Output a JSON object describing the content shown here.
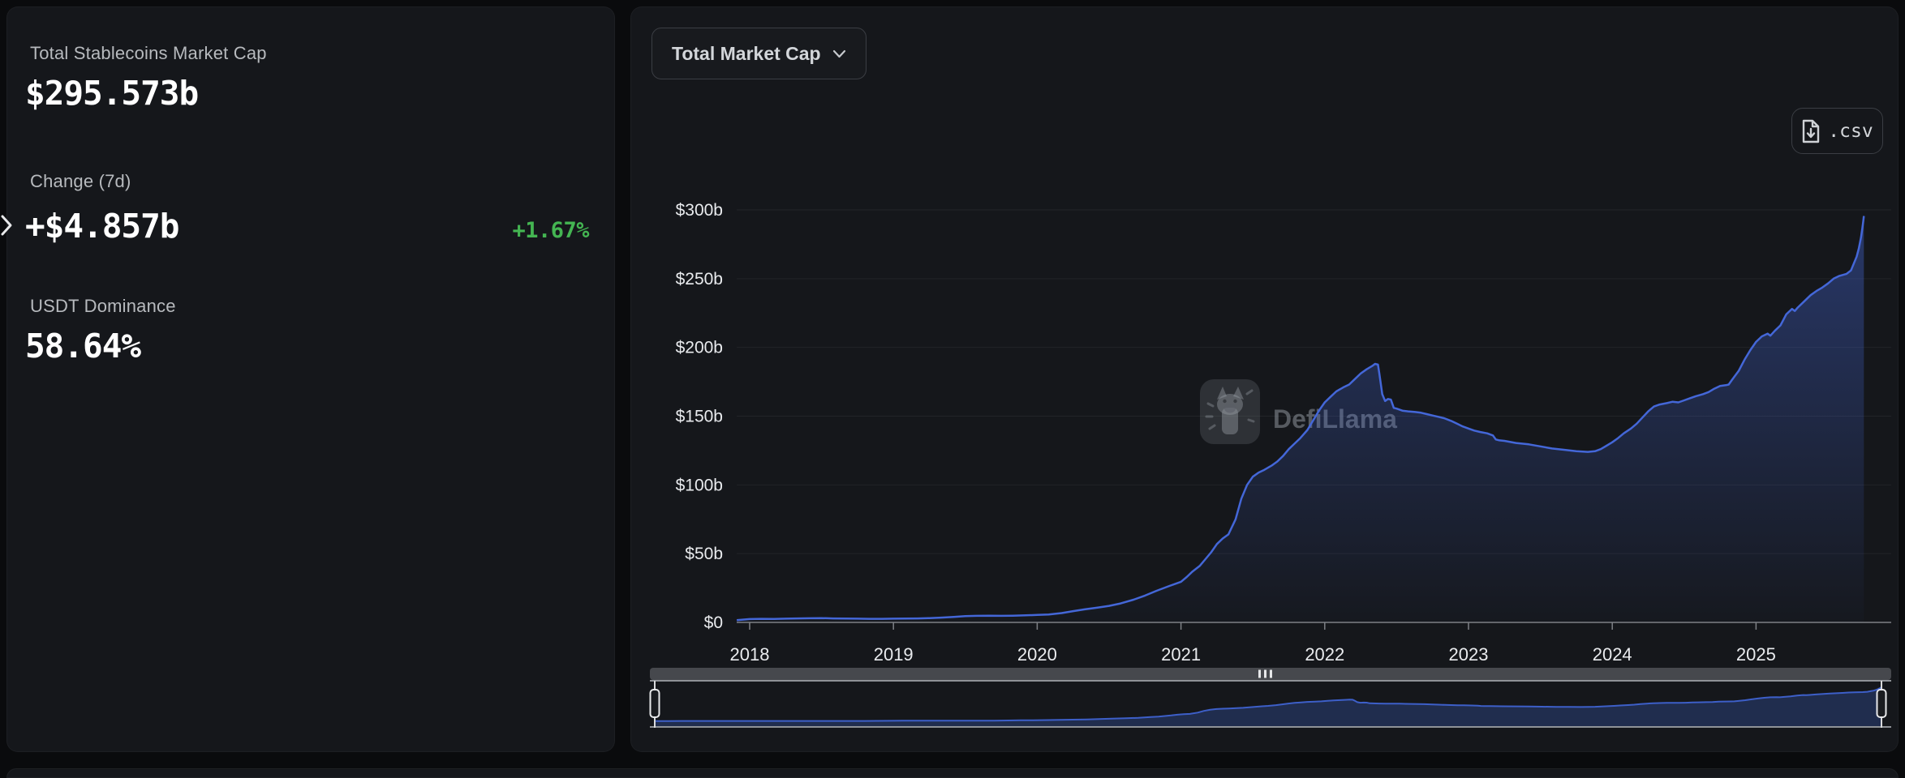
{
  "stats_panel": {
    "items": [
      {
        "label": "Total Stablecoins Market Cap",
        "value": "$295.573b"
      },
      {
        "label": "Change (7d)",
        "value": "+$4.857b",
        "change_pct": "+1.67%"
      },
      {
        "label": "USDT Dominance",
        "value": "58.64%"
      }
    ]
  },
  "chart_panel": {
    "metric_dropdown": {
      "label": "Total Market Cap"
    },
    "csv_button": {
      "label": ".csv"
    },
    "watermark": "DefiLlama"
  },
  "colors": {
    "positive_green": "#44b552",
    "line_blue": "#4467d8",
    "nav_fill_blue": "rgba(61,95,200,0.30)",
    "nav_line_blue": "#3d5fc8",
    "axis_gray": "#7e8186",
    "tick_text": "#e9ebee",
    "scrollbar_gray": "#46484d",
    "handle_stroke": "#e8e9eb"
  },
  "chart_data": {
    "type": "area",
    "title": "Total Market Cap",
    "xlabel": "",
    "ylabel": "",
    "ylim": [
      0,
      300
    ],
    "xlim": [
      2017.91,
      2025.75
    ],
    "grid": true,
    "legend_position": "none",
    "y_ticks": [
      "$0",
      "$50b",
      "$100b",
      "$150b",
      "$200b",
      "$250b",
      "$300b"
    ],
    "x_ticks": [
      "2018",
      "2019",
      "2020",
      "2021",
      "2022",
      "2023",
      "2024",
      "2025"
    ],
    "series": [
      {
        "name": "Total Stablecoins Market Cap",
        "unit": "USD billions",
        "points": [
          [
            2017.91,
            1.6
          ],
          [
            2018.0,
            2.4
          ],
          [
            2018.08,
            2.6
          ],
          [
            2018.17,
            2.5
          ],
          [
            2018.25,
            2.7
          ],
          [
            2018.33,
            2.9
          ],
          [
            2018.42,
            3.0
          ],
          [
            2018.5,
            3.1
          ],
          [
            2018.58,
            2.9
          ],
          [
            2018.67,
            2.8
          ],
          [
            2018.75,
            2.7
          ],
          [
            2018.83,
            2.6
          ],
          [
            2018.92,
            2.6
          ],
          [
            2019.0,
            2.7
          ],
          [
            2019.08,
            2.8
          ],
          [
            2019.17,
            2.9
          ],
          [
            2019.25,
            3.1
          ],
          [
            2019.33,
            3.5
          ],
          [
            2019.42,
            4.0
          ],
          [
            2019.5,
            4.6
          ],
          [
            2019.58,
            4.8
          ],
          [
            2019.67,
            4.9
          ],
          [
            2019.75,
            4.8
          ],
          [
            2019.83,
            4.9
          ],
          [
            2019.92,
            5.1
          ],
          [
            2020.0,
            5.4
          ],
          [
            2020.08,
            5.7
          ],
          [
            2020.17,
            6.8
          ],
          [
            2020.25,
            8.2
          ],
          [
            2020.33,
            9.5
          ],
          [
            2020.42,
            10.8
          ],
          [
            2020.5,
            12.0
          ],
          [
            2020.58,
            13.8
          ],
          [
            2020.67,
            16.5
          ],
          [
            2020.75,
            19.5
          ],
          [
            2020.83,
            23.0
          ],
          [
            2020.92,
            26.5
          ],
          [
            2021.0,
            29.5
          ],
          [
            2021.04,
            33
          ],
          [
            2021.08,
            37
          ],
          [
            2021.13,
            41
          ],
          [
            2021.17,
            46
          ],
          [
            2021.21,
            51
          ],
          [
            2021.25,
            57
          ],
          [
            2021.29,
            61
          ],
          [
            2021.33,
            64
          ],
          [
            2021.38,
            75
          ],
          [
            2021.42,
            90
          ],
          [
            2021.46,
            100
          ],
          [
            2021.5,
            106
          ],
          [
            2021.54,
            109
          ],
          [
            2021.58,
            111
          ],
          [
            2021.63,
            114
          ],
          [
            2021.67,
            117
          ],
          [
            2021.71,
            121
          ],
          [
            2021.75,
            126
          ],
          [
            2021.79,
            130
          ],
          [
            2021.83,
            134
          ],
          [
            2021.88,
            140
          ],
          [
            2021.92,
            147
          ],
          [
            2021.96,
            154
          ],
          [
            2022.0,
            160
          ],
          [
            2022.04,
            164
          ],
          [
            2022.08,
            168
          ],
          [
            2022.13,
            171
          ],
          [
            2022.17,
            173
          ],
          [
            2022.21,
            177
          ],
          [
            2022.25,
            181
          ],
          [
            2022.29,
            184
          ],
          [
            2022.33,
            186.5
          ],
          [
            2022.35,
            188
          ],
          [
            2022.37,
            187.5
          ],
          [
            2022.38,
            181
          ],
          [
            2022.4,
            166
          ],
          [
            2022.42,
            161
          ],
          [
            2022.44,
            162.5
          ],
          [
            2022.46,
            162
          ],
          [
            2022.48,
            156
          ],
          [
            2022.5,
            155.5
          ],
          [
            2022.54,
            154
          ],
          [
            2022.58,
            153.5
          ],
          [
            2022.63,
            153
          ],
          [
            2022.67,
            152.5
          ],
          [
            2022.71,
            151.5
          ],
          [
            2022.75,
            150.5
          ],
          [
            2022.79,
            149.5
          ],
          [
            2022.83,
            148.5
          ],
          [
            2022.88,
            146.5
          ],
          [
            2022.92,
            144.5
          ],
          [
            2022.96,
            142.5
          ],
          [
            2023.0,
            141
          ],
          [
            2023.04,
            139.5
          ],
          [
            2023.08,
            138.5
          ],
          [
            2023.13,
            137.5
          ],
          [
            2023.17,
            136
          ],
          [
            2023.19,
            133
          ],
          [
            2023.21,
            132.5
          ],
          [
            2023.25,
            132
          ],
          [
            2023.33,
            130.5
          ],
          [
            2023.42,
            129.5
          ],
          [
            2023.5,
            128
          ],
          [
            2023.58,
            126.5
          ],
          [
            2023.67,
            125.5
          ],
          [
            2023.75,
            124.5
          ],
          [
            2023.83,
            124
          ],
          [
            2023.88,
            124.5
          ],
          [
            2023.92,
            126
          ],
          [
            2023.96,
            128.5
          ],
          [
            2024.0,
            131
          ],
          [
            2024.04,
            134
          ],
          [
            2024.08,
            137.5
          ],
          [
            2024.13,
            141
          ],
          [
            2024.17,
            144.5
          ],
          [
            2024.21,
            149
          ],
          [
            2024.25,
            153.5
          ],
          [
            2024.29,
            157
          ],
          [
            2024.33,
            158.5
          ],
          [
            2024.38,
            159.5
          ],
          [
            2024.42,
            160.5
          ],
          [
            2024.46,
            160
          ],
          [
            2024.5,
            161.5
          ],
          [
            2024.54,
            163
          ],
          [
            2024.58,
            164.5
          ],
          [
            2024.63,
            166
          ],
          [
            2024.67,
            167.5
          ],
          [
            2024.71,
            170
          ],
          [
            2024.75,
            172
          ],
          [
            2024.79,
            172.5
          ],
          [
            2024.81,
            173
          ],
          [
            2024.83,
            176
          ],
          [
            2024.88,
            183
          ],
          [
            2024.92,
            191
          ],
          [
            2024.96,
            198
          ],
          [
            2025.0,
            204
          ],
          [
            2025.04,
            208
          ],
          [
            2025.08,
            210
          ],
          [
            2025.1,
            208.5
          ],
          [
            2025.13,
            212
          ],
          [
            2025.17,
            216
          ],
          [
            2025.21,
            224
          ],
          [
            2025.25,
            228
          ],
          [
            2025.27,
            226.5
          ],
          [
            2025.29,
            229
          ],
          [
            2025.33,
            233
          ],
          [
            2025.38,
            238
          ],
          [
            2025.42,
            241
          ],
          [
            2025.46,
            243.5
          ],
          [
            2025.5,
            246.5
          ],
          [
            2025.54,
            250
          ],
          [
            2025.58,
            252
          ],
          [
            2025.63,
            253.5
          ],
          [
            2025.66,
            256
          ],
          [
            2025.68,
            261
          ],
          [
            2025.7,
            266
          ],
          [
            2025.715,
            272
          ],
          [
            2025.73,
            280
          ],
          [
            2025.74,
            287
          ],
          [
            2025.745,
            291
          ],
          [
            2025.75,
            295.573
          ]
        ]
      }
    ]
  }
}
